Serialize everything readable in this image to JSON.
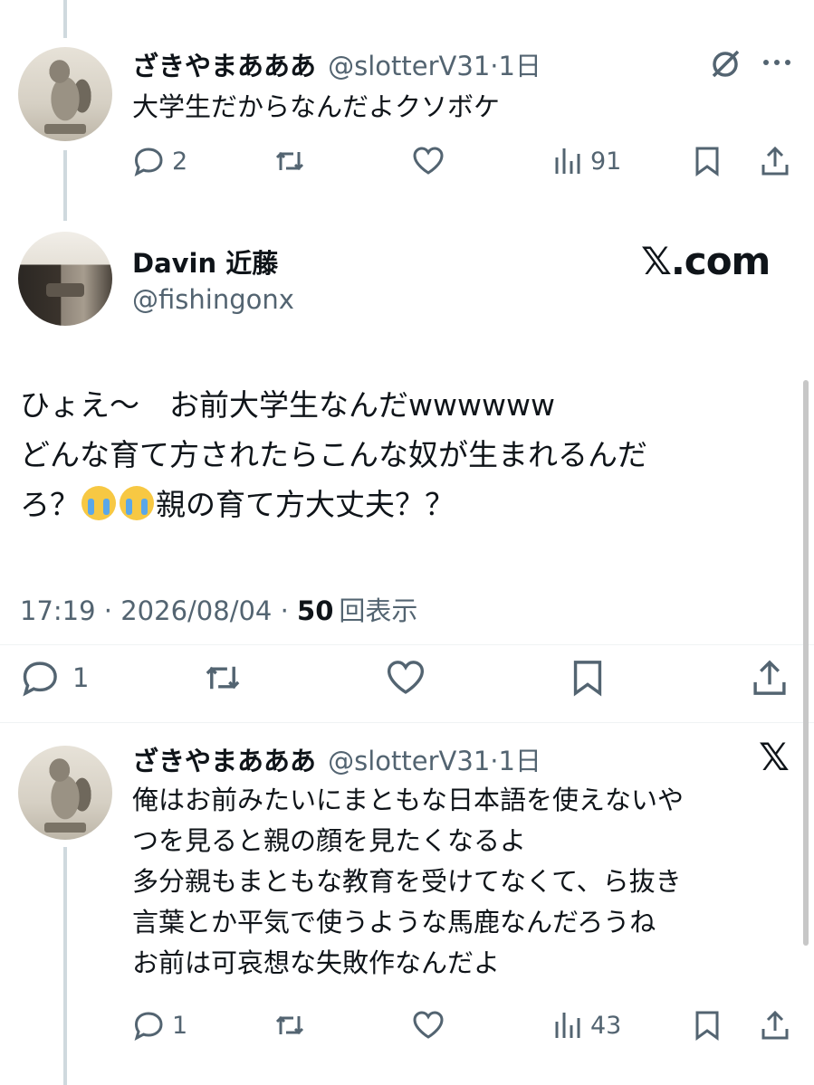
{
  "reply1": {
    "name": "ざきやまあああ",
    "handle": "@slotterV31",
    "time": "1日",
    "text": "大学生だからなんだよクソボケ",
    "replies": "2",
    "views": "91"
  },
  "main": {
    "name": "Davin 近藤",
    "handle": "@fishingonx",
    "watermark": "𝕏.com",
    "line1": "ひょえ〜　お前大学生なんだwwwwww",
    "line2": "どんな育て方されたらこんな奴が生まれるんだ",
    "line3a": "ろ？",
    "line3b": "親の育て方大丈夫？？",
    "timestamp": "17:19 · 2026/08/04 · ",
    "views_count": "50",
    "views_label": "回表示",
    "replies": "1"
  },
  "reply2": {
    "name": "ざきやまあああ",
    "handle": "@slotterV31",
    "time": "1日",
    "badge": "𝕏",
    "text": "俺はお前みたいにまともな日本語を使えないや\nつを見ると親の顔を見たくなるよ\n多分親もまともな教育を受けてなくて、ら抜き\n言葉とか平気で使うような馬鹿なんだろうね\nお前は可哀想な失敗作なんだよ",
    "replies": "1",
    "views": "43"
  },
  "icons": [
    "reply-icon",
    "retweet-icon",
    "like-icon",
    "views-icon",
    "bookmark-icon",
    "share-icon",
    "grok-icon",
    "more-icon",
    "crying-emoji"
  ],
  "colors": {
    "text": "#0f1419",
    "secondary": "#536471",
    "thread_line": "#cfd9de"
  }
}
